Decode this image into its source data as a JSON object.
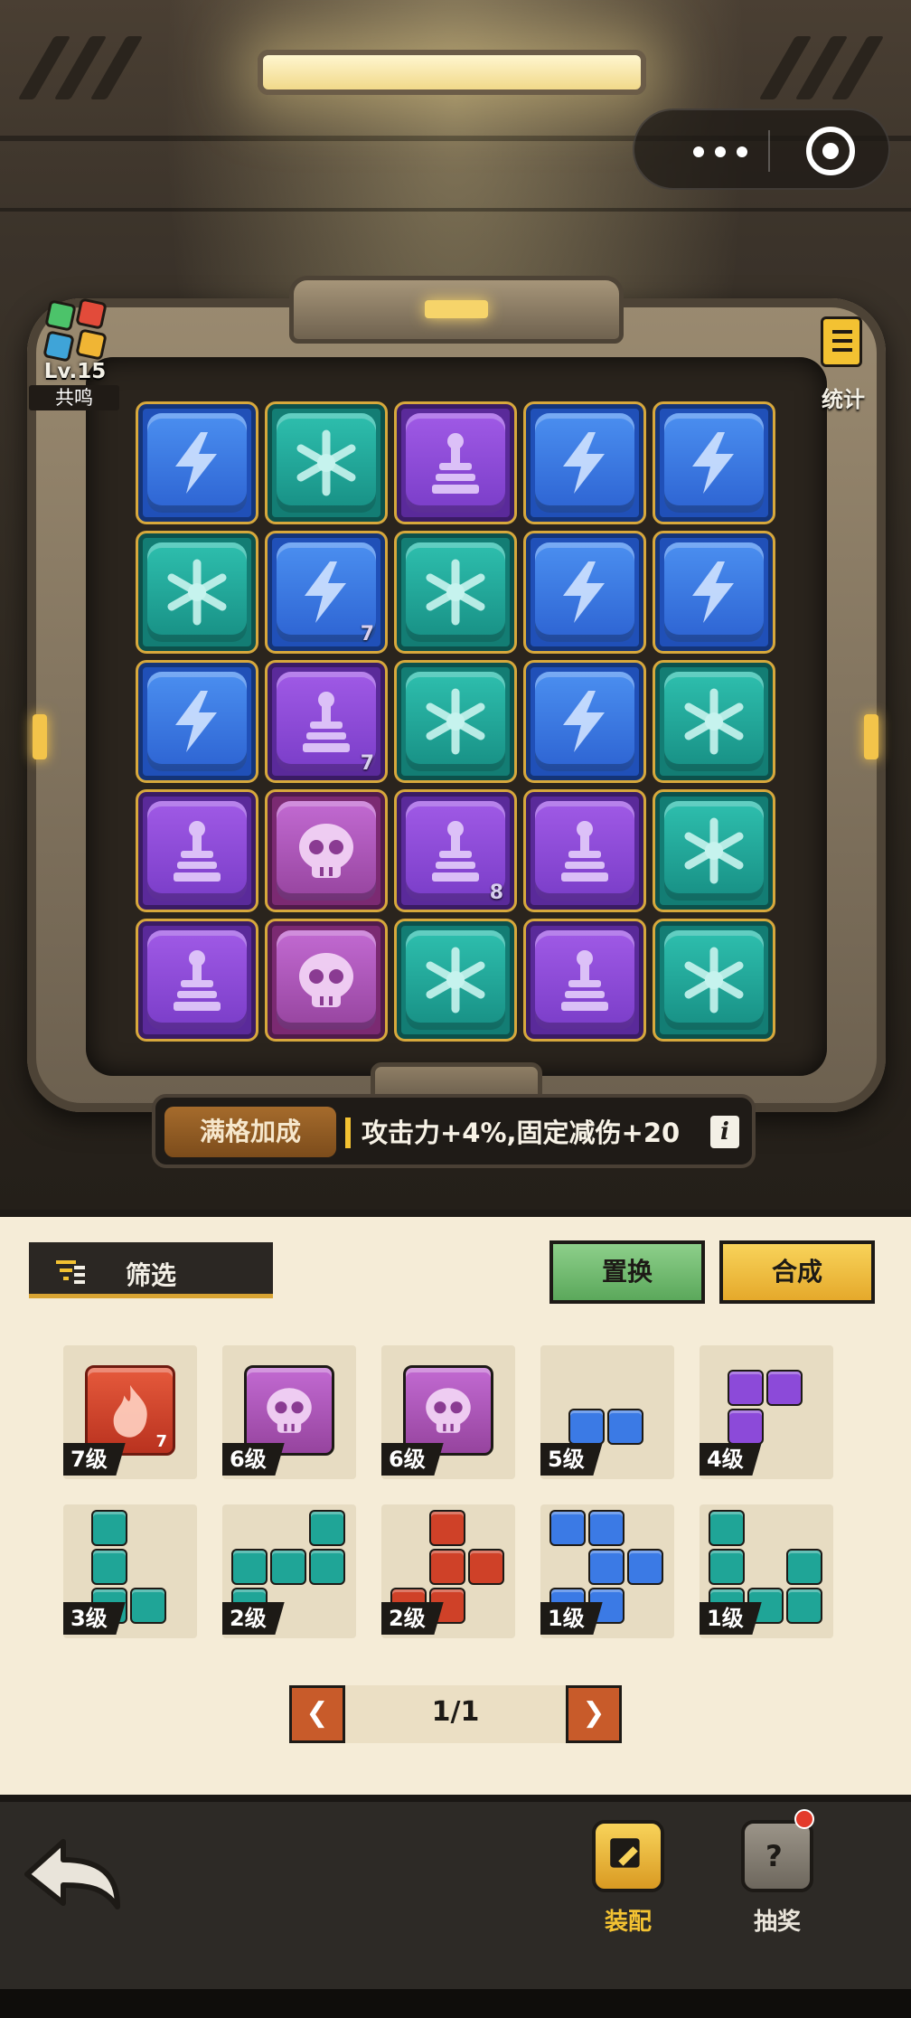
{
  "resonance": {
    "level": "Lv.15",
    "label": "共鸣"
  },
  "stats": {
    "label": "统计"
  },
  "grid": {
    "rows": [
      [
        {
          "type": "lightning",
          "level": ""
        },
        {
          "type": "frost",
          "level": ""
        },
        {
          "type": "totem",
          "level": ""
        },
        {
          "type": "lightning",
          "level": ""
        },
        {
          "type": "lightning",
          "level": ""
        }
      ],
      [
        {
          "type": "frost",
          "level": ""
        },
        {
          "type": "lightning",
          "level": "7"
        },
        {
          "type": "frost",
          "level": ""
        },
        {
          "type": "lightning",
          "level": ""
        },
        {
          "type": "lightning",
          "level": ""
        }
      ],
      [
        {
          "type": "lightning",
          "level": ""
        },
        {
          "type": "totem",
          "level": "7"
        },
        {
          "type": "frost",
          "level": ""
        },
        {
          "type": "lightning",
          "level": ""
        },
        {
          "type": "frost",
          "level": ""
        }
      ],
      [
        {
          "type": "totem",
          "level": ""
        },
        {
          "type": "skull",
          "level": ""
        },
        {
          "type": "totem",
          "level": "8"
        },
        {
          "type": "totem",
          "level": ""
        },
        {
          "type": "frost",
          "level": ""
        }
      ],
      [
        {
          "type": "totem",
          "level": ""
        },
        {
          "type": "skull",
          "level": ""
        },
        {
          "type": "frost",
          "level": ""
        },
        {
          "type": "totem",
          "level": ""
        },
        {
          "type": "frost",
          "level": ""
        }
      ]
    ]
  },
  "bonus": {
    "tag": "满格加成",
    "text": "攻击力+4%,固定减伤+20",
    "info": "i"
  },
  "filter": {
    "label": "筛选"
  },
  "buttons": {
    "replace": "置换",
    "merge": "合成"
  },
  "inventory": [
    {
      "tier": "7级"
    },
    {
      "tier": "6级"
    },
    {
      "tier": "6级"
    },
    {
      "tier": "5级"
    },
    {
      "tier": "4级"
    },
    {
      "tier": "3级"
    },
    {
      "tier": "2级"
    },
    {
      "tier": "2级"
    },
    {
      "tier": "1级"
    },
    {
      "tier": "1级"
    }
  ],
  "inventory_big_levels": {
    "fire": "7"
  },
  "pager": {
    "prev": "❮",
    "page": "1/1",
    "next": "❯"
  },
  "nav": {
    "equip": "装配",
    "lottery": "抽奖"
  },
  "colors": {
    "lightning": "#3b7ae5",
    "frost": "#1fa597",
    "totem": "#8c4ad9",
    "skull": "#a950b5",
    "fire": "#cf4128",
    "accent": "#f3c232"
  }
}
